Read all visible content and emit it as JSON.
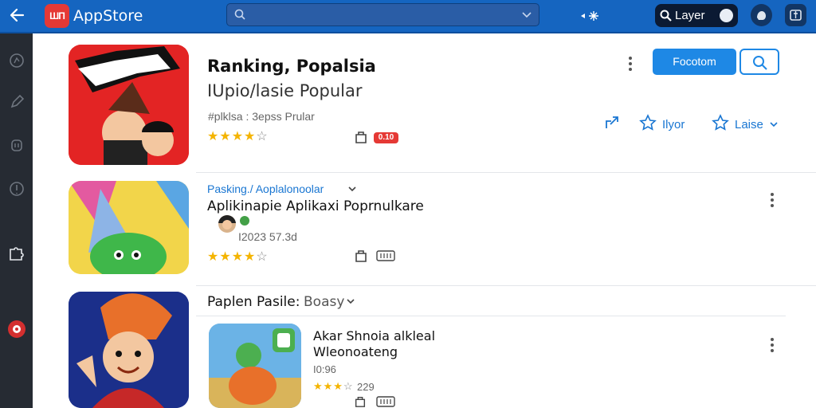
{
  "topbar": {
    "app_name": "AppStore",
    "logo_text": "ШП",
    "search_value": "",
    "search_placeholder": "",
    "layer_label": "Layer"
  },
  "header_app": {
    "title": "Ranking, Popalsia",
    "subtitle": "IUpio/lasie Popular",
    "meta": "#plklsa : 3epss Prular",
    "rating": 4,
    "badge": "0.10",
    "install_label": "Focotom",
    "actions": [
      {
        "label": "Ilyor"
      },
      {
        "label": "Laise"
      }
    ]
  },
  "section_two": {
    "breadcrumb": "Pasking./ Aoplalonoolar",
    "title": "Aplikinapie Aplikaxi Poprnulkare",
    "meta": "I2023 57.3d",
    "rating": 4
  },
  "section_three": {
    "header_label": "Paplen Pasile:",
    "header_value": "Boasy",
    "title": "Akar Shnoia alkleal",
    "subtitle": "Wleonoateng",
    "meta": "I0:96",
    "rating": 3,
    "reviews": "229"
  },
  "colors": {
    "topbar": "#1565c0",
    "sidebar": "#262b33",
    "accent": "#1e88e5",
    "star": "#f4b400",
    "badge": "#e53935"
  }
}
